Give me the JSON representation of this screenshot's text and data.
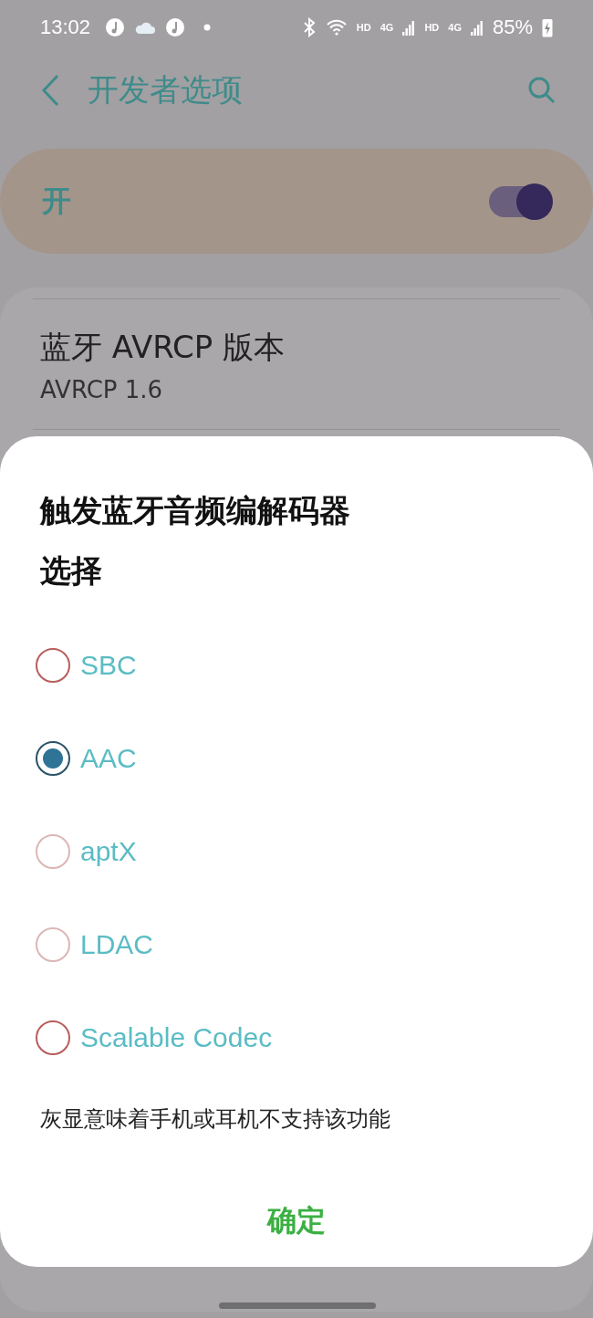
{
  "status_bar": {
    "time": "13:02",
    "sims": [
      {
        "hd": "HD",
        "network": "4G"
      },
      {
        "hd": "HD",
        "network": "4G"
      }
    ],
    "battery": "85%"
  },
  "header": {
    "title": "开发者选项"
  },
  "master_switch": {
    "label": "开",
    "on": true
  },
  "settings": [
    {
      "title": "蓝牙 AVRCP 版本",
      "value": "AVRCP 1.6"
    }
  ],
  "dialog": {
    "title": "触发蓝牙音频编解码器选择",
    "options": [
      {
        "label": "SBC",
        "selected": false,
        "disabled": false
      },
      {
        "label": "AAC",
        "selected": true,
        "disabled": false
      },
      {
        "label": "aptX",
        "selected": false,
        "disabled": true
      },
      {
        "label": "LDAC",
        "selected": false,
        "disabled": true
      },
      {
        "label": "Scalable Codec",
        "selected": false,
        "disabled": false
      }
    ],
    "note": "灰显意味着手机或耳机不支持该功能",
    "confirm": "确定"
  }
}
